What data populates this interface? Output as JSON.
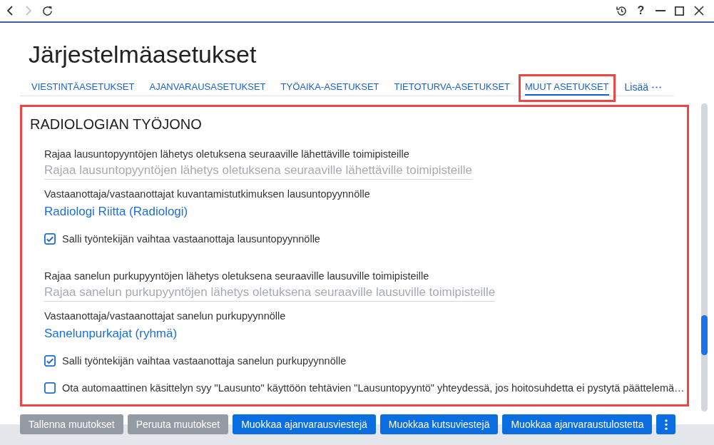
{
  "toolbar": {
    "nav_buttons": [
      {
        "kind": "back",
        "disabled": false
      },
      {
        "kind": "forward",
        "disabled": true
      },
      {
        "kind": "reload",
        "disabled": false
      }
    ],
    "window_buttons": [
      {
        "kind": "history"
      },
      {
        "kind": "help",
        "glyph": "?"
      },
      {
        "kind": "minimize"
      },
      {
        "kind": "maximize"
      },
      {
        "kind": "close"
      }
    ]
  },
  "page_title": "Järjestelmäasetukset",
  "tabs": [
    {
      "label": "VIESTINTÄASETUKSET",
      "selected": false,
      "highlighted": false
    },
    {
      "label": "AJANVARAUSASETUKSET",
      "selected": false,
      "highlighted": false
    },
    {
      "label": "TYÖAIKA-ASETUKSET",
      "selected": false,
      "highlighted": false
    },
    {
      "label": "TIETOTURVA-ASETUKSET",
      "selected": false,
      "highlighted": false
    },
    {
      "label": "MUUT ASETUKSET",
      "selected": true,
      "highlighted": true
    }
  ],
  "more_tabs": {
    "label": "Lisää"
  },
  "section": {
    "title": "RADIOLOGIAN TYÖJONO",
    "highlighted": true,
    "groups": [
      {
        "fields": [
          {
            "kind": "picker",
            "label": "Rajaa lausuntopyyntöjen lähetys oletuksena seuraaville lähettäville toimipisteille",
            "placeholder": "Rajaa lausuntopyyntöjen lähetys oletuksena seuraaville lähettäville toimipisteille"
          },
          {
            "kind": "recipient",
            "label": "Vastaanottaja/vastaanottajat kuvantamistutkimuksen lausuntopyynnölle",
            "value": "Radiologi Riitta (Radiologi)"
          },
          {
            "kind": "checkbox",
            "label": "Salli työntekijän vaihtaa vastaanottaja lausuntopyynnölle",
            "checked": true
          }
        ]
      },
      {
        "fields": [
          {
            "kind": "picker",
            "label": "Rajaa sanelun purkupyyntöjen lähetys oletuksena seuraaville lausuville toimipisteille",
            "placeholder": "Rajaa sanelun purkupyyntöjen lähetys oletuksena seuraaville lausuville toimipisteille"
          },
          {
            "kind": "recipient",
            "label": "Vastaanottaja/vastaanottajat sanelun purkupyynnölle",
            "value": "Sanelunpurkajat (ryhmä)"
          },
          {
            "kind": "checkbox",
            "label": "Salli työntekijän vaihtaa vastaanottaja sanelun purkupyynnölle",
            "checked": true
          },
          {
            "kind": "checkbox",
            "label": "Ota automaattinen käsittelyn syy \"Lausunto\" käyttöön tehtävien \"Lausuntopyyntö\" yhteydessä, jos hoitosuhdetta ei pystytä päättelemä…",
            "checked": false
          }
        ]
      }
    ]
  },
  "footer_buttons": [
    {
      "kind": "text",
      "label": "Tallenna muutokset",
      "disabled": true
    },
    {
      "kind": "text",
      "label": "Peruuta muutokset",
      "disabled": true
    },
    {
      "kind": "text",
      "label": "Muokkaa ajanvarausviestejä",
      "disabled": false
    },
    {
      "kind": "text",
      "label": "Muokkaa kutsuviestejä",
      "disabled": false
    },
    {
      "kind": "text",
      "label": "Muokkaa ajanvaraustulostetta",
      "disabled": false
    },
    {
      "kind": "menu",
      "disabled": false
    }
  ]
}
